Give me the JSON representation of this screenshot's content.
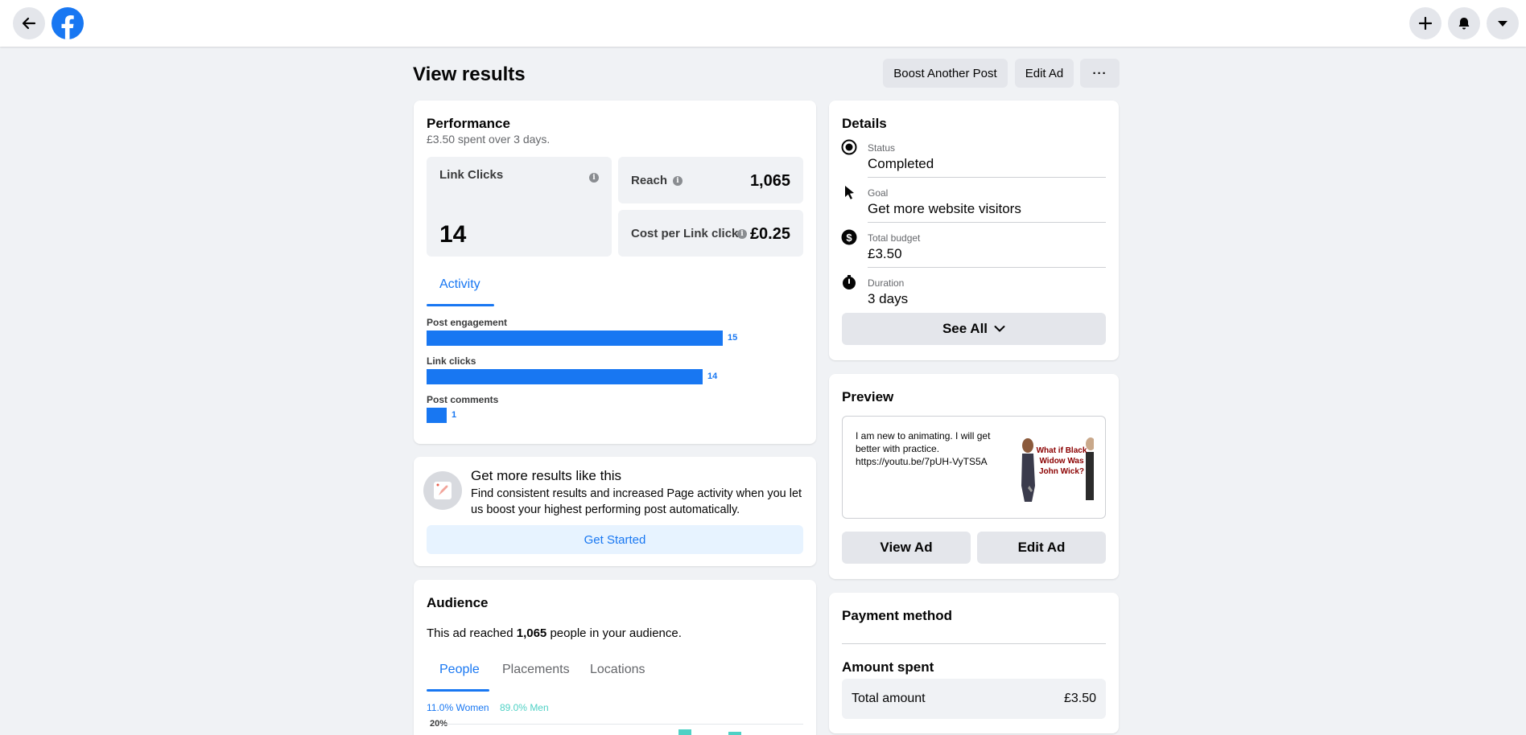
{
  "topbar": {
    "back_icon": "arrow-left-icon",
    "logo_icon": "facebook-logo-icon",
    "create_icon": "plus-icon",
    "notifications_icon": "bell-icon",
    "account_icon": "caret-down-icon"
  },
  "header": {
    "title": "View results",
    "boost_another_post": "Boost Another Post",
    "edit_ad": "Edit Ad",
    "more": "···"
  },
  "performance": {
    "title": "Performance",
    "subtitle": "£3.50 spent over 3 days.",
    "link_clicks": {
      "label": "Link Clicks",
      "value": "14"
    },
    "reach": {
      "label": "Reach",
      "value": "1,065"
    },
    "cost_per_link_click": {
      "label": "Cost per Link click",
      "value": "£0.25"
    },
    "tab": "Activity"
  },
  "activity": {
    "max": 15,
    "rows": [
      {
        "label": "Post engagement",
        "value": 15
      },
      {
        "label": "Link clicks",
        "value": 14
      },
      {
        "label": "Post comments",
        "value": 1
      }
    ]
  },
  "promo": {
    "title": "Get more results like this",
    "body": "Find consistent results and increased Page activity when you let us boost your highest performing post automatically.",
    "button": "Get Started"
  },
  "audience": {
    "title": "Audience",
    "reached_prefix": "This ad reached ",
    "reached_count": "1,065",
    "reached_suffix": " people in your audience.",
    "tabs": [
      "People",
      "Placements",
      "Locations"
    ],
    "women": "11.0% Women",
    "men": "89.0% Men",
    "y_tick": "20%",
    "colors": {
      "women": "#1877f2",
      "men": "#4fd1c5"
    }
  },
  "details": {
    "title": "Details",
    "status": {
      "label": "Status",
      "value": "Completed",
      "icon": "radio-icon"
    },
    "goal": {
      "label": "Goal",
      "value": "Get more website visitors",
      "icon": "cursor-icon"
    },
    "budget": {
      "label": "Total budget",
      "value": "£3.50",
      "icon": "dollar-icon"
    },
    "duration": {
      "label": "Duration",
      "value": "3 days",
      "icon": "stopwatch-icon"
    },
    "see_all": "See All"
  },
  "preview": {
    "title": "Preview",
    "text": "I am new to animating. I will get better with practice. https://youtu.be/7pUH-VyTS5A",
    "thumb_text": "What if Black Widow Was John Wick?",
    "view_ad": "View Ad",
    "edit_ad": "Edit Ad"
  },
  "payment": {
    "title": "Payment method",
    "amount_spent": "Amount spent",
    "total_label": "Total amount",
    "total_value": "£3.50"
  }
}
